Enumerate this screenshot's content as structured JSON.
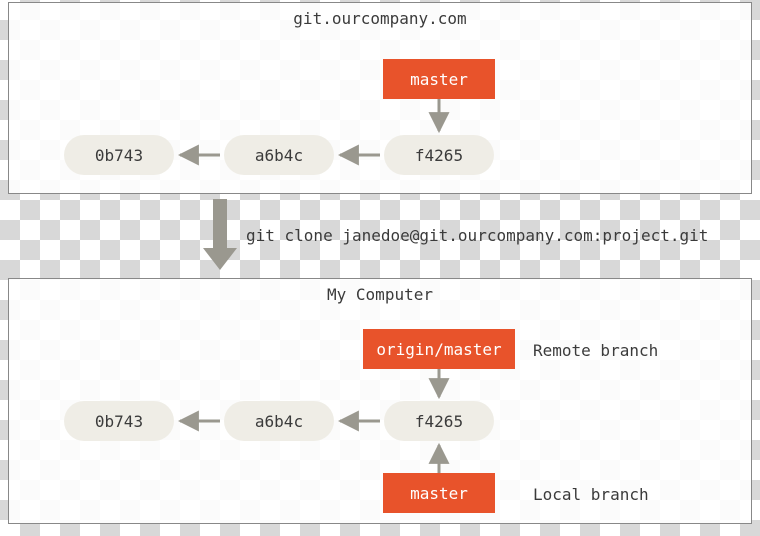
{
  "server": {
    "title": "git.ourcompany.com",
    "branch": "master",
    "commits": [
      "0b743",
      "a6b4c",
      "f4265"
    ]
  },
  "clone_command": "git clone janedoe@git.ourcompany.com:project.git",
  "client": {
    "title": "My Computer",
    "remote_branch": "origin/master",
    "remote_branch_label": "Remote branch",
    "local_branch": "master",
    "local_branch_label": "Local branch",
    "commits": [
      "0b743",
      "a6b4c",
      "f4265"
    ]
  },
  "colors": {
    "accent": "#e8532b",
    "commit_bg": "#efede6",
    "panel_border": "#888888"
  }
}
